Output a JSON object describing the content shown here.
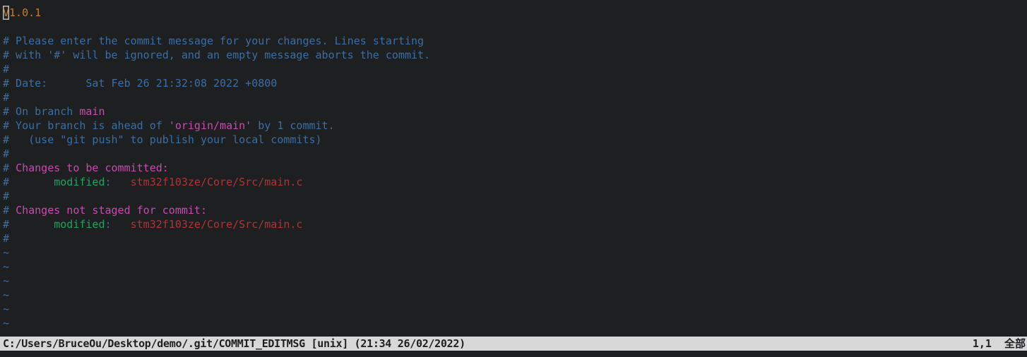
{
  "editor": {
    "name": "vim",
    "mode": "normal",
    "background_color": "#1d1f21",
    "cursor": {
      "character": "V",
      "row": 1,
      "column": 1,
      "style": "block-outline",
      "outline_color": "#b9b9b9"
    },
    "colors": {
      "comment": "#3a6ea5",
      "subject": "#c87b1e",
      "branch": "#c94ab0",
      "section_header": "#c94ab0",
      "staged_label": "#1aa563",
      "file_path": "#b0333a",
      "tilde": "#3a6ea5",
      "statusline_bg": "#d8d8d8",
      "statusline_fg": "#1d1f21"
    }
  },
  "buffer": {
    "line1": {
      "cursor_char": "V",
      "rest": "1.0.1"
    },
    "blank": "",
    "line3": "# Please enter the commit message for your changes. Lines starting",
    "line4": "# with '#' will be ignored, and an empty message aborts the commit.",
    "hash": "#",
    "date_label": "# Date:",
    "date_value": "Sat Feb 26 21:32:08 2022 +0800",
    "on_branch_prefix": "# On branch ",
    "on_branch_name": "main",
    "ahead_pre": "# Your branch is ahead of ",
    "ahead_remote": "'origin/main'",
    "ahead_post": " by 1 commit.",
    "push_hint": "#   (use \"git push\" to publish your local commits)",
    "staged_header_hash": "# ",
    "staged_header_text": "Changes to be committed:",
    "staged_indent": "#       ",
    "staged_label": "modified",
    "staged_colon": ":",
    "staged_gap": "   ",
    "staged_file": "stm32f103ze/Core/Src/main.c",
    "unstaged_header_hash": "# ",
    "unstaged_header_text": "Changes not staged for commit:",
    "unstaged_indent": "#       ",
    "unstaged_label": "modified",
    "unstaged_colon": ":",
    "unstaged_gap": "   ",
    "unstaged_file": "stm32f103ze/Core/Src/main.c",
    "tilde": "~"
  },
  "statusline": {
    "file_path": "C:/Users/BruceOu/Desktop/demo/.git/COMMIT_EDITMSG",
    "fileformat": "[unix]",
    "modified_time": "(21:34 26/02/2022)",
    "left_full": "C:/Users/BruceOu/Desktop/demo/.git/COMMIT_EDITMSG [unix] (21:34 26/02/2022)",
    "position": "1,1",
    "scroll_percent": "全部"
  }
}
